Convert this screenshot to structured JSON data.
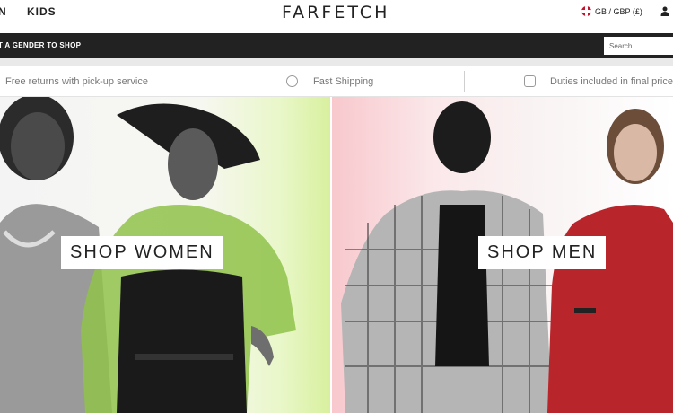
{
  "header": {
    "nav_partial": "N",
    "nav_kids": "KIDS",
    "logo": "FARFETCH",
    "region": "GB / GBP (£)",
    "gender_prompt": "T A GENDER TO SHOP",
    "search_placeholder": "Search"
  },
  "info": {
    "returns": "Free returns with pick-up service",
    "shipping": "Fast Shipping",
    "duties": "Duties included in final price"
  },
  "hero": {
    "women_label": "SHOP WOMEN",
    "men_label": "SHOP MEN"
  },
  "colors": {
    "dark_bar": "#222222",
    "info_text": "#777777",
    "women_bg_accent": "#d8f09e",
    "men_bg_accent": "#f8c8cd"
  }
}
